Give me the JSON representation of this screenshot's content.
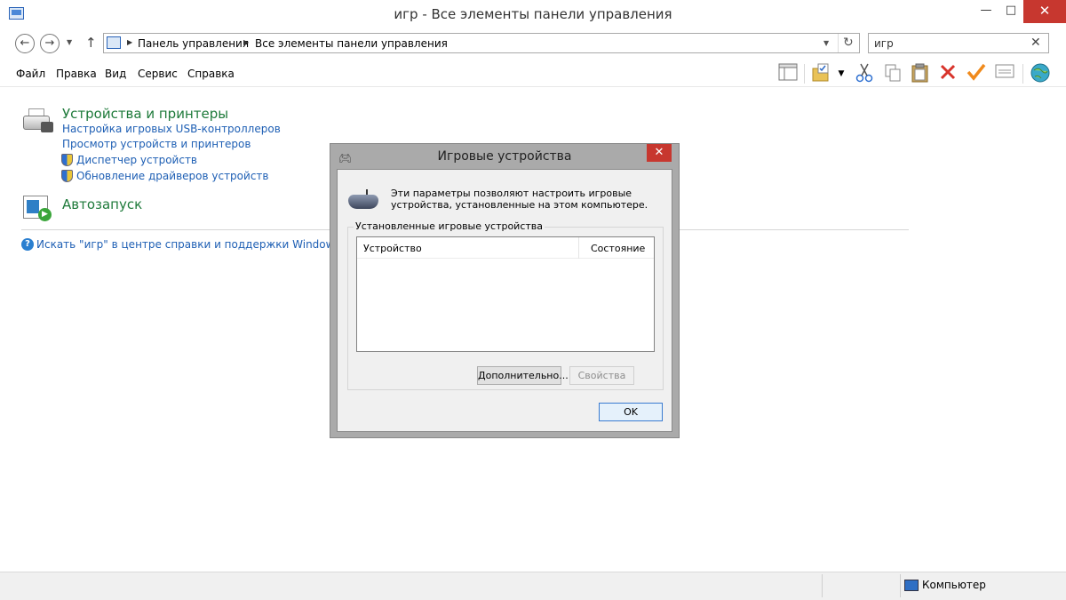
{
  "window": {
    "title": "игр - Все элементы панели управления",
    "controls": {
      "minimize": "—",
      "maximize": "□",
      "close": "✕"
    }
  },
  "nav": {
    "back_icon": "←",
    "forward_icon": "→",
    "dropdown_icon": "▼",
    "up_icon": "↑",
    "breadcrumb": [
      "Панель управления",
      "Все элементы панели управления"
    ],
    "breadcrumb_separator": "▶",
    "refresh_icon": "↻",
    "search_value": "игр",
    "search_clear": "✕"
  },
  "menu": {
    "items": [
      "Файл",
      "Правка",
      "Вид",
      "Сервис",
      "Справка"
    ]
  },
  "toolbar": {
    "icons": [
      "layout-pane-icon",
      "folder-check-icon",
      "dropdown-arrow-icon",
      "cut-icon",
      "copy-icon",
      "paste-icon",
      "delete-icon",
      "checkmark-icon",
      "properties-icon",
      "globe-icon"
    ]
  },
  "content": {
    "devices": {
      "title": "Устройства и принтеры",
      "links": [
        "Настройка игровых USB-контроллеров",
        "Просмотр устройств и принтеров",
        "Диспетчер устройств",
        "Обновление драйверов устройств"
      ]
    },
    "autorun": {
      "title": "Автозапуск"
    },
    "help_link": "Искать \"игр\" в центре справки и поддержки Windows"
  },
  "statusbar": {
    "computer": "Компьютер"
  },
  "dialog": {
    "title": "Игровые устройства",
    "close": "✕",
    "description": "Эти параметры позволяют настроить игровые устройства, установленные на этом компьютере.",
    "group_label": "Установленные игровые устройства",
    "columns": [
      "Устройство",
      "Состояние"
    ],
    "rows": [],
    "advanced_button": "Дополнительно...",
    "properties_button": "Свойства",
    "ok_button": "OK"
  },
  "colors": {
    "category_title": "#1e7a3a",
    "link": "#1e5fb4",
    "close_red": "#c7372f"
  }
}
